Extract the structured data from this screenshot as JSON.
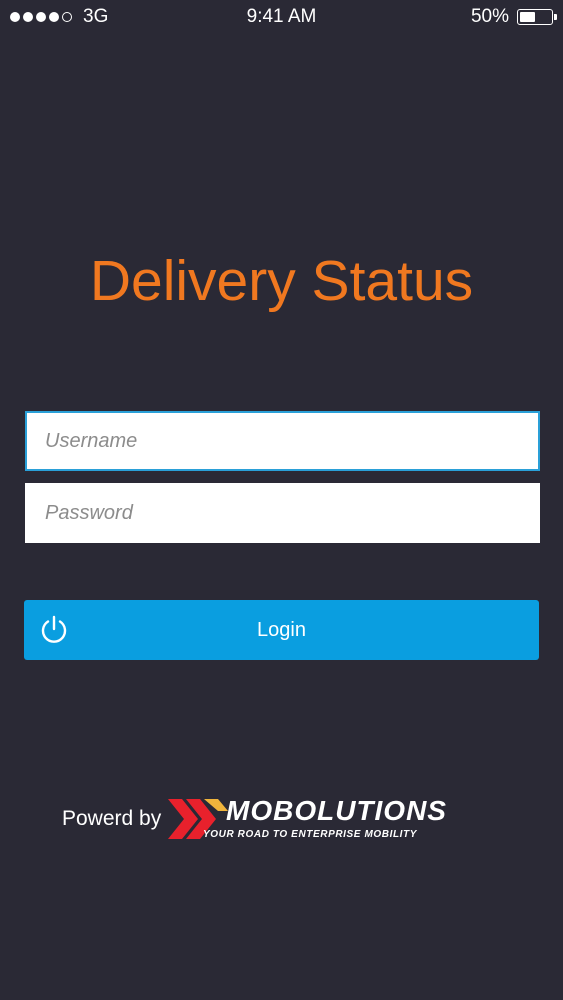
{
  "status_bar": {
    "carrier": "3G",
    "time": "9:41 AM",
    "battery_percent": "50%",
    "battery_level": 0.5,
    "signal_bars_filled": 4,
    "signal_bars_total": 5
  },
  "app": {
    "title": "Delivery Status",
    "title_color": "#f07820"
  },
  "form": {
    "username_placeholder": "Username",
    "password_placeholder": "Password",
    "login_label": "Login",
    "login_color": "#0a9ee0",
    "login_icon": "power-icon"
  },
  "footer": {
    "powered_by": "Powerd by",
    "brand_name": "MOBOLUTIONS",
    "brand_tagline": "YOUR ROAD TO ENTERPRISE MOBILITY",
    "brand_colors": [
      "#e8212c",
      "#f0b43c"
    ]
  }
}
